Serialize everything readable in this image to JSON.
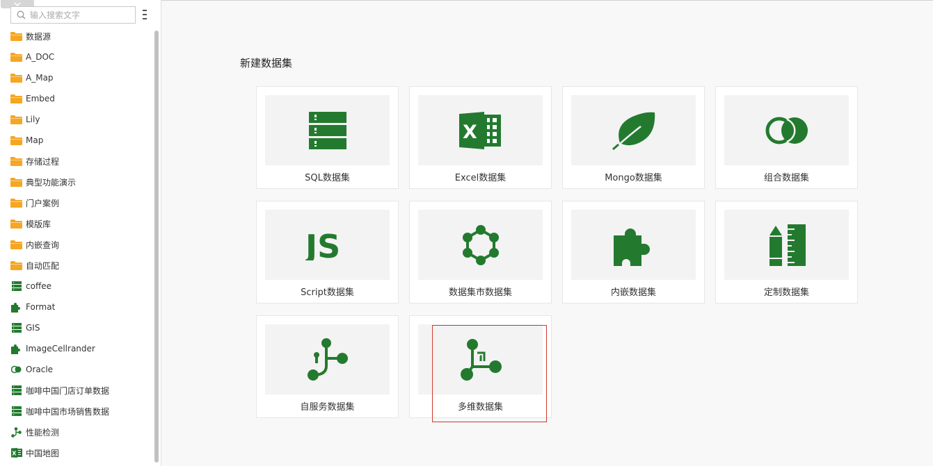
{
  "search": {
    "placeholder": "输入搜索文字"
  },
  "sidebar": {
    "items": [
      {
        "label": "数据源",
        "icon": "folder-icon"
      },
      {
        "label": "A_DOC",
        "icon": "folder-icon"
      },
      {
        "label": "A_Map",
        "icon": "folder-icon"
      },
      {
        "label": "Embed",
        "icon": "folder-icon"
      },
      {
        "label": "Lily",
        "icon": "folder-icon"
      },
      {
        "label": "Map",
        "icon": "folder-icon"
      },
      {
        "label": "存储过程",
        "icon": "folder-icon"
      },
      {
        "label": "典型功能演示",
        "icon": "folder-icon"
      },
      {
        "label": "门户案例",
        "icon": "folder-icon"
      },
      {
        "label": "模版库",
        "icon": "folder-icon"
      },
      {
        "label": "内嵌查询",
        "icon": "folder-icon"
      },
      {
        "label": "自动匹配",
        "icon": "folder-icon"
      },
      {
        "label": "coffee",
        "icon": "database-icon"
      },
      {
        "label": "Format",
        "icon": "puzzle-icon"
      },
      {
        "label": "GIS",
        "icon": "database-icon"
      },
      {
        "label": "ImageCellrander",
        "icon": "puzzle-icon"
      },
      {
        "label": "Oracle",
        "icon": "circles-icon"
      },
      {
        "label": "咖啡中国门店订单数据",
        "icon": "database-icon"
      },
      {
        "label": "咖啡中国市场销售数据",
        "icon": "database-icon"
      },
      {
        "label": "性能检测",
        "icon": "branch-icon"
      },
      {
        "label": "中国地图",
        "icon": "excel-icon"
      }
    ]
  },
  "main": {
    "title": "新建数据集",
    "cards": [
      {
        "label": "SQL数据集",
        "icon": "database-icon"
      },
      {
        "label": "Excel数据集",
        "icon": "excel-icon"
      },
      {
        "label": "Mongo数据集",
        "icon": "leaf-icon"
      },
      {
        "label": "组合数据集",
        "icon": "circles-icon"
      },
      {
        "label": "Script数据集",
        "icon": "js-icon"
      },
      {
        "label": "数据集市数据集",
        "icon": "hexagon-network-icon"
      },
      {
        "label": "内嵌数据集",
        "icon": "puzzle-icon"
      },
      {
        "label": "定制数据集",
        "icon": "pencil-ruler-icon"
      },
      {
        "label": "自服务数据集",
        "icon": "branch-icon"
      },
      {
        "label": "多维数据集",
        "icon": "cube-axis-icon"
      }
    ],
    "selected_card": "多维数据集"
  },
  "colors": {
    "icon_green": "#237a2f",
    "folder_orange": "#f5a623",
    "highlight_red": "#d0392b"
  }
}
